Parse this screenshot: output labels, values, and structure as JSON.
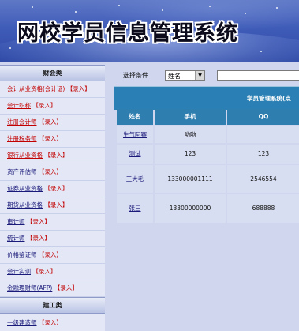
{
  "header": {
    "title": "网校学员信息管理系统"
  },
  "sidebar": {
    "sections": [
      {
        "heading": "财会类",
        "items": [
          {
            "label": "会计从业资格(会计证)",
            "action": "【录入】",
            "style": "red"
          },
          {
            "label": "会计职称",
            "action": "【录入】",
            "style": "red"
          },
          {
            "label": "注册会计师",
            "action": "【录入】",
            "style": "red"
          },
          {
            "label": "注册税务师",
            "action": "【录入】",
            "style": "red"
          },
          {
            "label": "银行从业资格",
            "action": "【录入】",
            "style": "red"
          },
          {
            "label": "资产评估师",
            "action": "【录入】",
            "style": "plain"
          },
          {
            "label": "证券从业资格",
            "action": "【录入】",
            "style": "plain"
          },
          {
            "label": "期货从业资格",
            "action": "【录入】",
            "style": "plain"
          },
          {
            "label": "审计师",
            "action": "【录入】",
            "style": "plain"
          },
          {
            "label": "统计师",
            "action": "【录入】",
            "style": "plain"
          },
          {
            "label": "价格鉴证师",
            "action": "【录入】",
            "style": "plain"
          },
          {
            "label": "会计实训",
            "action": "【录入】",
            "style": "plain"
          },
          {
            "label": "金融理财师(AFP)",
            "action": "【录入】",
            "style": "plain"
          }
        ]
      },
      {
        "heading": "建工类",
        "items": [
          {
            "label": "一级建造师",
            "action": "【录入】",
            "style": "plain"
          }
        ]
      }
    ]
  },
  "filter": {
    "label": "选择条件",
    "select_value": "姓名",
    "search_value": ""
  },
  "table": {
    "caption": "学员管理系统(点",
    "columns": [
      "姓名",
      "手机",
      "QQ"
    ],
    "rows": [
      {
        "name": "生气阿赛",
        "phone": "哟哟",
        "qq": ""
      },
      {
        "name": "测试",
        "phone": "123",
        "qq": "123"
      },
      {
        "name": "王大毛",
        "phone": "133000001111",
        "qq": "2546554"
      },
      {
        "name": "张三",
        "phone": "13300000000",
        "qq": "688888"
      }
    ]
  }
}
